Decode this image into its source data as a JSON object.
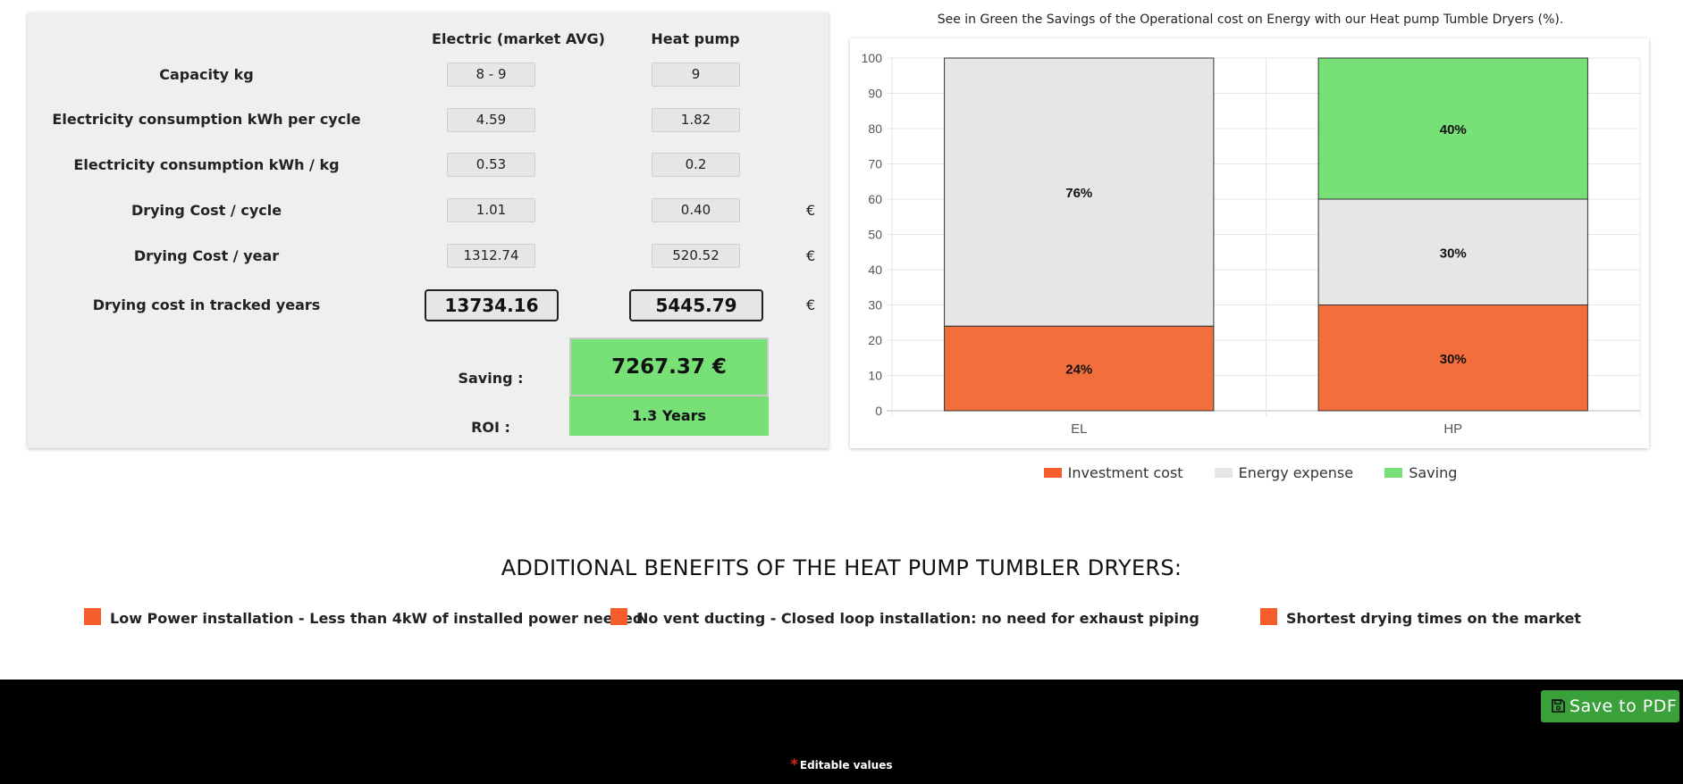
{
  "comparison": {
    "columns": [
      "Electric (market AVG)",
      "Heat pump"
    ],
    "rows": [
      {
        "label": "Capacity kg",
        "electric": "8 - 9",
        "heat_pump": "9",
        "unit": ""
      },
      {
        "label": "Electricity consumption kWh per cycle",
        "electric": "4.59",
        "heat_pump": "1.82",
        "unit": ""
      },
      {
        "label": "Electricity consumption kWh / kg",
        "electric": "0.53",
        "heat_pump": "0.2",
        "unit": ""
      },
      {
        "label": "Drying Cost / cycle",
        "electric": "1.01",
        "heat_pump": "0.40",
        "unit": "€"
      },
      {
        "label": "Drying Cost / year",
        "electric": "1312.74",
        "heat_pump": "520.52",
        "unit": "€"
      }
    ],
    "tracked": {
      "label": "Drying cost in tracked years",
      "electric": "13734.16",
      "heat_pump": "5445.79",
      "unit": "€"
    },
    "saving": {
      "label": "Saving :",
      "value": "7267.37 €"
    },
    "roi": {
      "label": "ROI :",
      "value": "1.3 Years"
    }
  },
  "chart_caption": "See in Green the Savings of the Operational cost on Energy with our Heat pump Tumble Dryers (%).",
  "chart_data": {
    "type": "bar",
    "stacked": true,
    "categories": [
      "EL",
      "HP"
    ],
    "series": [
      {
        "name": "Investment cost",
        "values": [
          24,
          30
        ],
        "labels": [
          "24%",
          "30%"
        ],
        "color": "#f26e3d"
      },
      {
        "name": "Energy expense",
        "values": [
          76,
          30
        ],
        "labels": [
          "76%",
          "30%"
        ],
        "color": "#e6e6e6"
      },
      {
        "name": "Saving",
        "values": [
          0,
          40
        ],
        "labels": [
          "",
          "40%"
        ],
        "color": "#77e077"
      }
    ],
    "ylim": [
      0,
      100
    ],
    "yticks": [
      "0",
      "10",
      "20",
      "30",
      "40",
      "50",
      "60",
      "70",
      "80",
      "90",
      "100"
    ],
    "grid": true,
    "legend": "bottom"
  },
  "legend": [
    {
      "label": "Investment cost",
      "color": "#f55e2a"
    },
    {
      "label": "Energy expense",
      "color": "#e6e6e6"
    },
    {
      "label": "Saving",
      "color": "#77e077"
    }
  ],
  "benefits": {
    "title": "ADDITIONAL BENEFITS OF THE HEAT PUMP TUMBLER DRYERS:",
    "items": [
      "Low Power installation - Less than 4kW of installed power needed",
      "No vent ducting - Closed loop installation: no need for exhaust piping",
      "Shortest drying times on the market"
    ]
  },
  "footer": {
    "pdf_button": "Save to PDF",
    "editable_star": "*",
    "editable_note": "Editable values"
  }
}
